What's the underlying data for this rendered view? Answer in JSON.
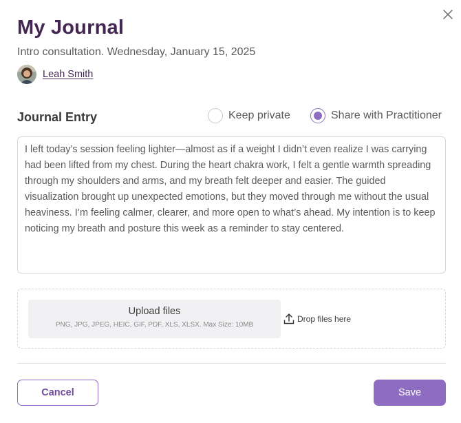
{
  "modal": {
    "title": "My Journal",
    "subtitle": "Intro consultation. Wednesday, January 15, 2025",
    "person_name": "Leah Smith"
  },
  "entry": {
    "section_title": "Journal Entry",
    "visibility_options": [
      {
        "label": "Keep private",
        "selected": false
      },
      {
        "label": "Share with Practitioner",
        "selected": true
      }
    ],
    "text": "I left today’s session feeling lighter—almost as if a weight I didn’t even realize I was carrying had been lifted from my chest. During the heart chakra work, I felt a gentle warmth spreading through my shoulders and arms, and my breath felt deeper and easier. The guided visualization brought up unexpected emotions, but they moved through me without the usual heaviness. I’m feeling calmer, clearer, and more open to what’s ahead. My intention is to keep noticing my breath and posture this week as a reminder to stay centered."
  },
  "upload": {
    "title": "Upload files",
    "hint": "PNG, JPG, JPEG, HEIC, GIF, PDF, XLS, XLSX. Max Size: 10MB",
    "drop_label": "Drop files here",
    "drop_icon": "upload-icon"
  },
  "actions": {
    "cancel_label": "Cancel",
    "save_label": "Save"
  },
  "colors": {
    "accent": "#8e6cc2",
    "title": "#432752"
  }
}
